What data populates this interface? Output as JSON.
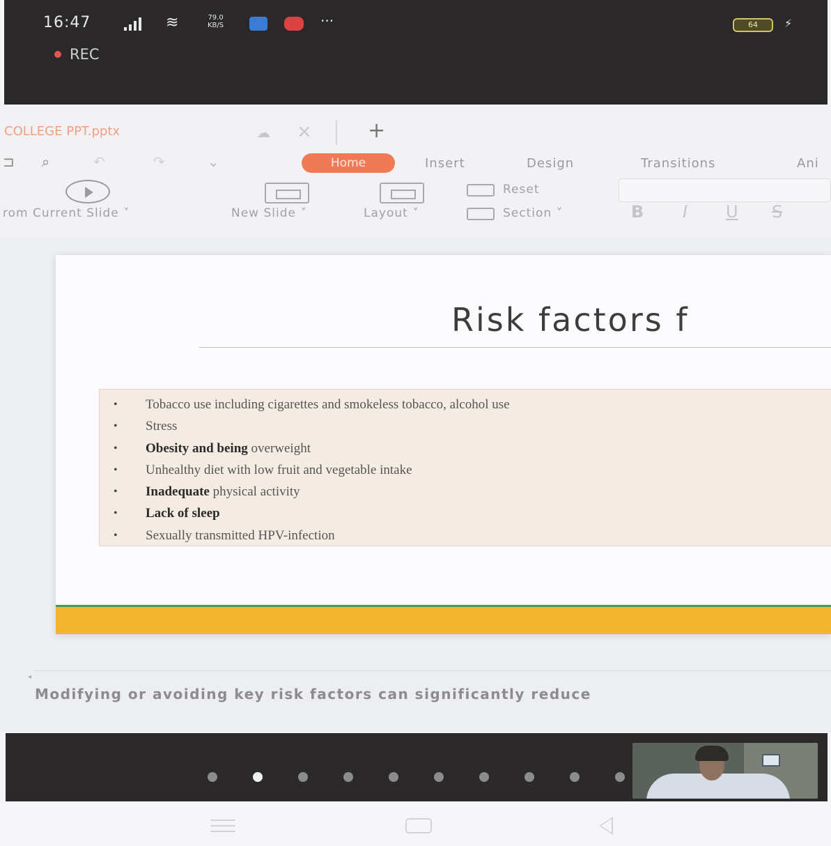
{
  "status_bar": {
    "time": "16:47",
    "net_speed_value": "79.0",
    "net_speed_unit": "KB/S",
    "more": "···",
    "battery": "64",
    "recording_label": "REC"
  },
  "document_tab": {
    "title": "COLLEGE PPT.pptx",
    "new_tab": "+"
  },
  "ribbon": {
    "tabs": [
      "Home",
      "Insert",
      "Design",
      "Transitions",
      "Ani"
    ],
    "commands": {
      "from_current_slide": "rom Current Slide ˅",
      "new_slide": "New Slide ˅",
      "layout": "Layout ˅",
      "reset": "Reset",
      "section": "Section ˅"
    },
    "format_buttons": [
      "B",
      "I",
      "U",
      "S"
    ]
  },
  "slide": {
    "title": "Risk factors f",
    "bullets": [
      {
        "bold": "",
        "text": "Tobacco use including cigarettes and smokeless tobacco, alcohol use"
      },
      {
        "bold": "",
        "text": "Stress"
      },
      {
        "bold": "Obesity and being",
        "text": " overweight"
      },
      {
        "bold": "",
        "text": "Unhealthy diet with low fruit and vegetable intake"
      },
      {
        "bold": "Inadequate",
        "text": " physical activity"
      },
      {
        "bold": "Lack of sleep",
        "text": ""
      },
      {
        "bold": "",
        "text": "Sexually transmitted HPV-infection"
      }
    ]
  },
  "notes": "Modifying or avoiding key risk factors can significantly reduce",
  "pagination": {
    "count": 10,
    "active_index": 1
  },
  "colors": {
    "accent_tab": "#f07a56",
    "slide_green": "#3da24a",
    "slide_orange": "#f1b52e",
    "bullet_box": "#f4ebe2"
  }
}
